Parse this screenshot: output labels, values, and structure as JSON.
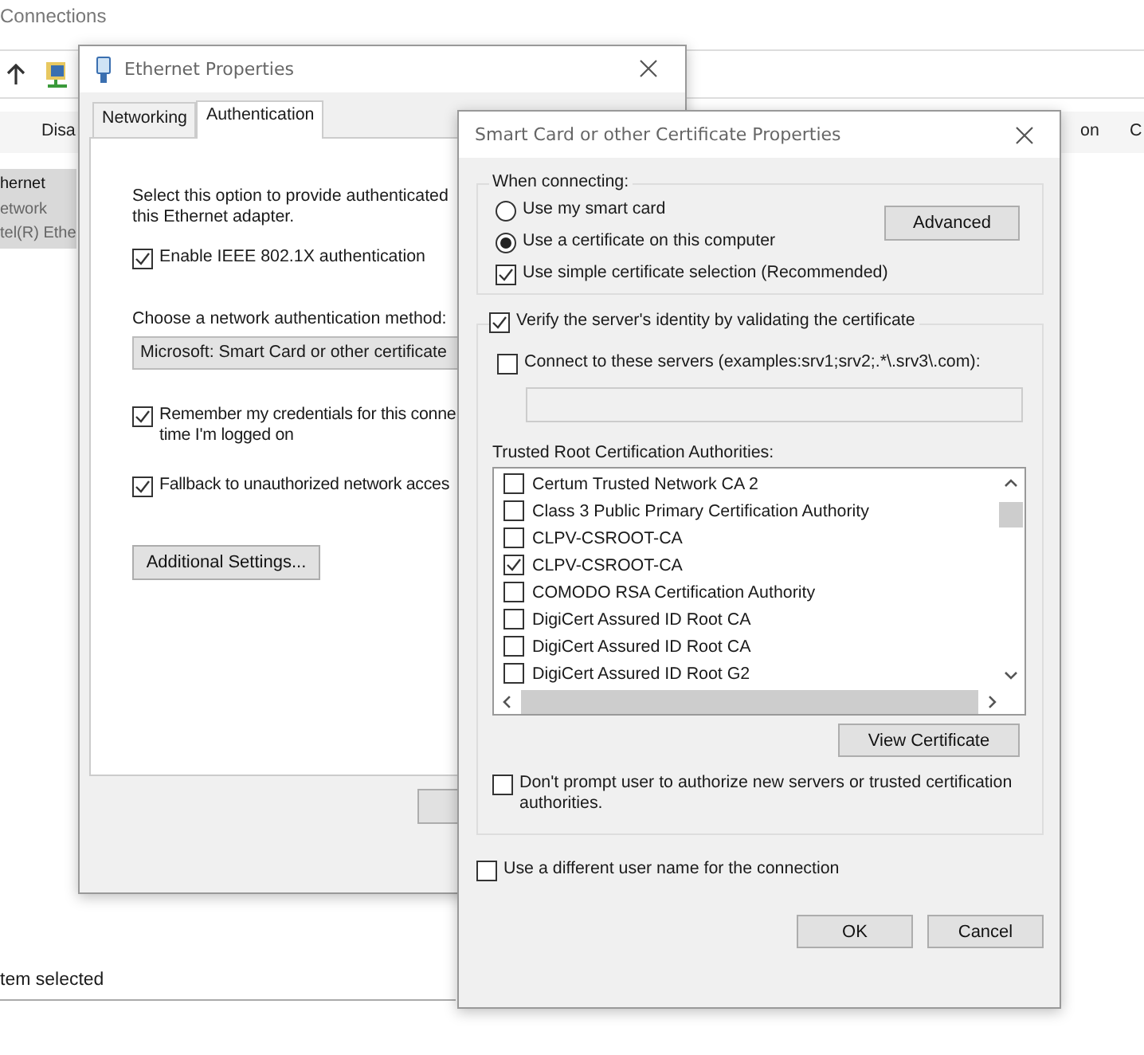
{
  "explorer": {
    "title": "Connections",
    "toolbar": [
      "Disa",
      "on",
      "C"
    ],
    "item": {
      "name": "hernet",
      "lines": [
        "etwork",
        "tel(R) Ethe"
      ],
      "selected": true
    },
    "status_bar": "tem selected"
  },
  "ethernet": {
    "title": "Ethernet Properties",
    "tabs": [
      {
        "label": "Networking",
        "selected": false
      },
      {
        "label": "Authentication",
        "selected": true
      }
    ],
    "description": [
      "Select this option to provide authenticated",
      "this Ethernet adapter."
    ],
    "enable": {
      "label": "Enable IEEE 802.1X authentication",
      "checked": true
    },
    "method_label": "Choose a network authentication method:",
    "method_value": "Microsoft: Smart Card or other certificate",
    "options": [
      {
        "lines": [
          "Remember my credentials for this conne",
          "time I'm logged on"
        ],
        "checked": true
      },
      {
        "lines": [
          "Fallback to unauthorized network acces"
        ],
        "checked": true
      }
    ],
    "additional_button": "Additional Settings..."
  },
  "dialog": {
    "title": "Smart Card or other Certificate Properties",
    "connecting": {
      "legend": "When connecting:",
      "radios": [
        {
          "label": "Use my smart card",
          "selected": false
        },
        {
          "label": "Use a certificate on this computer",
          "selected": true
        }
      ],
      "simple": {
        "label": "Use simple certificate selection (Recommended)",
        "checked": true
      },
      "advanced_button": "Advanced"
    },
    "verify": {
      "label": "Verify the server's identity by validating the certificate",
      "checked": true
    },
    "connect_servers": {
      "label": "Connect to these servers (examples:srv1;srv2;.*\\.srv3\\.com):",
      "checked": false
    },
    "trusted_label": "Trusted Root Certification Authorities:",
    "authorities": [
      {
        "name": "Certum Trusted Network CA 2",
        "checked": false
      },
      {
        "name": "Class 3 Public Primary Certification Authority",
        "checked": false
      },
      {
        "name": "CLPV-CSROOT-CA",
        "checked": false
      },
      {
        "name": "CLPV-CSROOT-CA",
        "checked": true
      },
      {
        "name": "COMODO RSA Certification Authority",
        "checked": false
      },
      {
        "name": "DigiCert Assured ID Root CA",
        "checked": false
      },
      {
        "name": "DigiCert Assured ID Root CA",
        "checked": false
      },
      {
        "name": "DigiCert Assured ID Root G2",
        "checked": false
      }
    ],
    "view_button": "View Certificate",
    "dont_prompt": {
      "label": "Don't prompt user to authorize new servers or trusted certification authorities.",
      "checked": false
    },
    "different_user": {
      "label": "Use a different user name for the connection",
      "checked": false
    },
    "buttons": [
      "OK",
      "Cancel"
    ]
  }
}
